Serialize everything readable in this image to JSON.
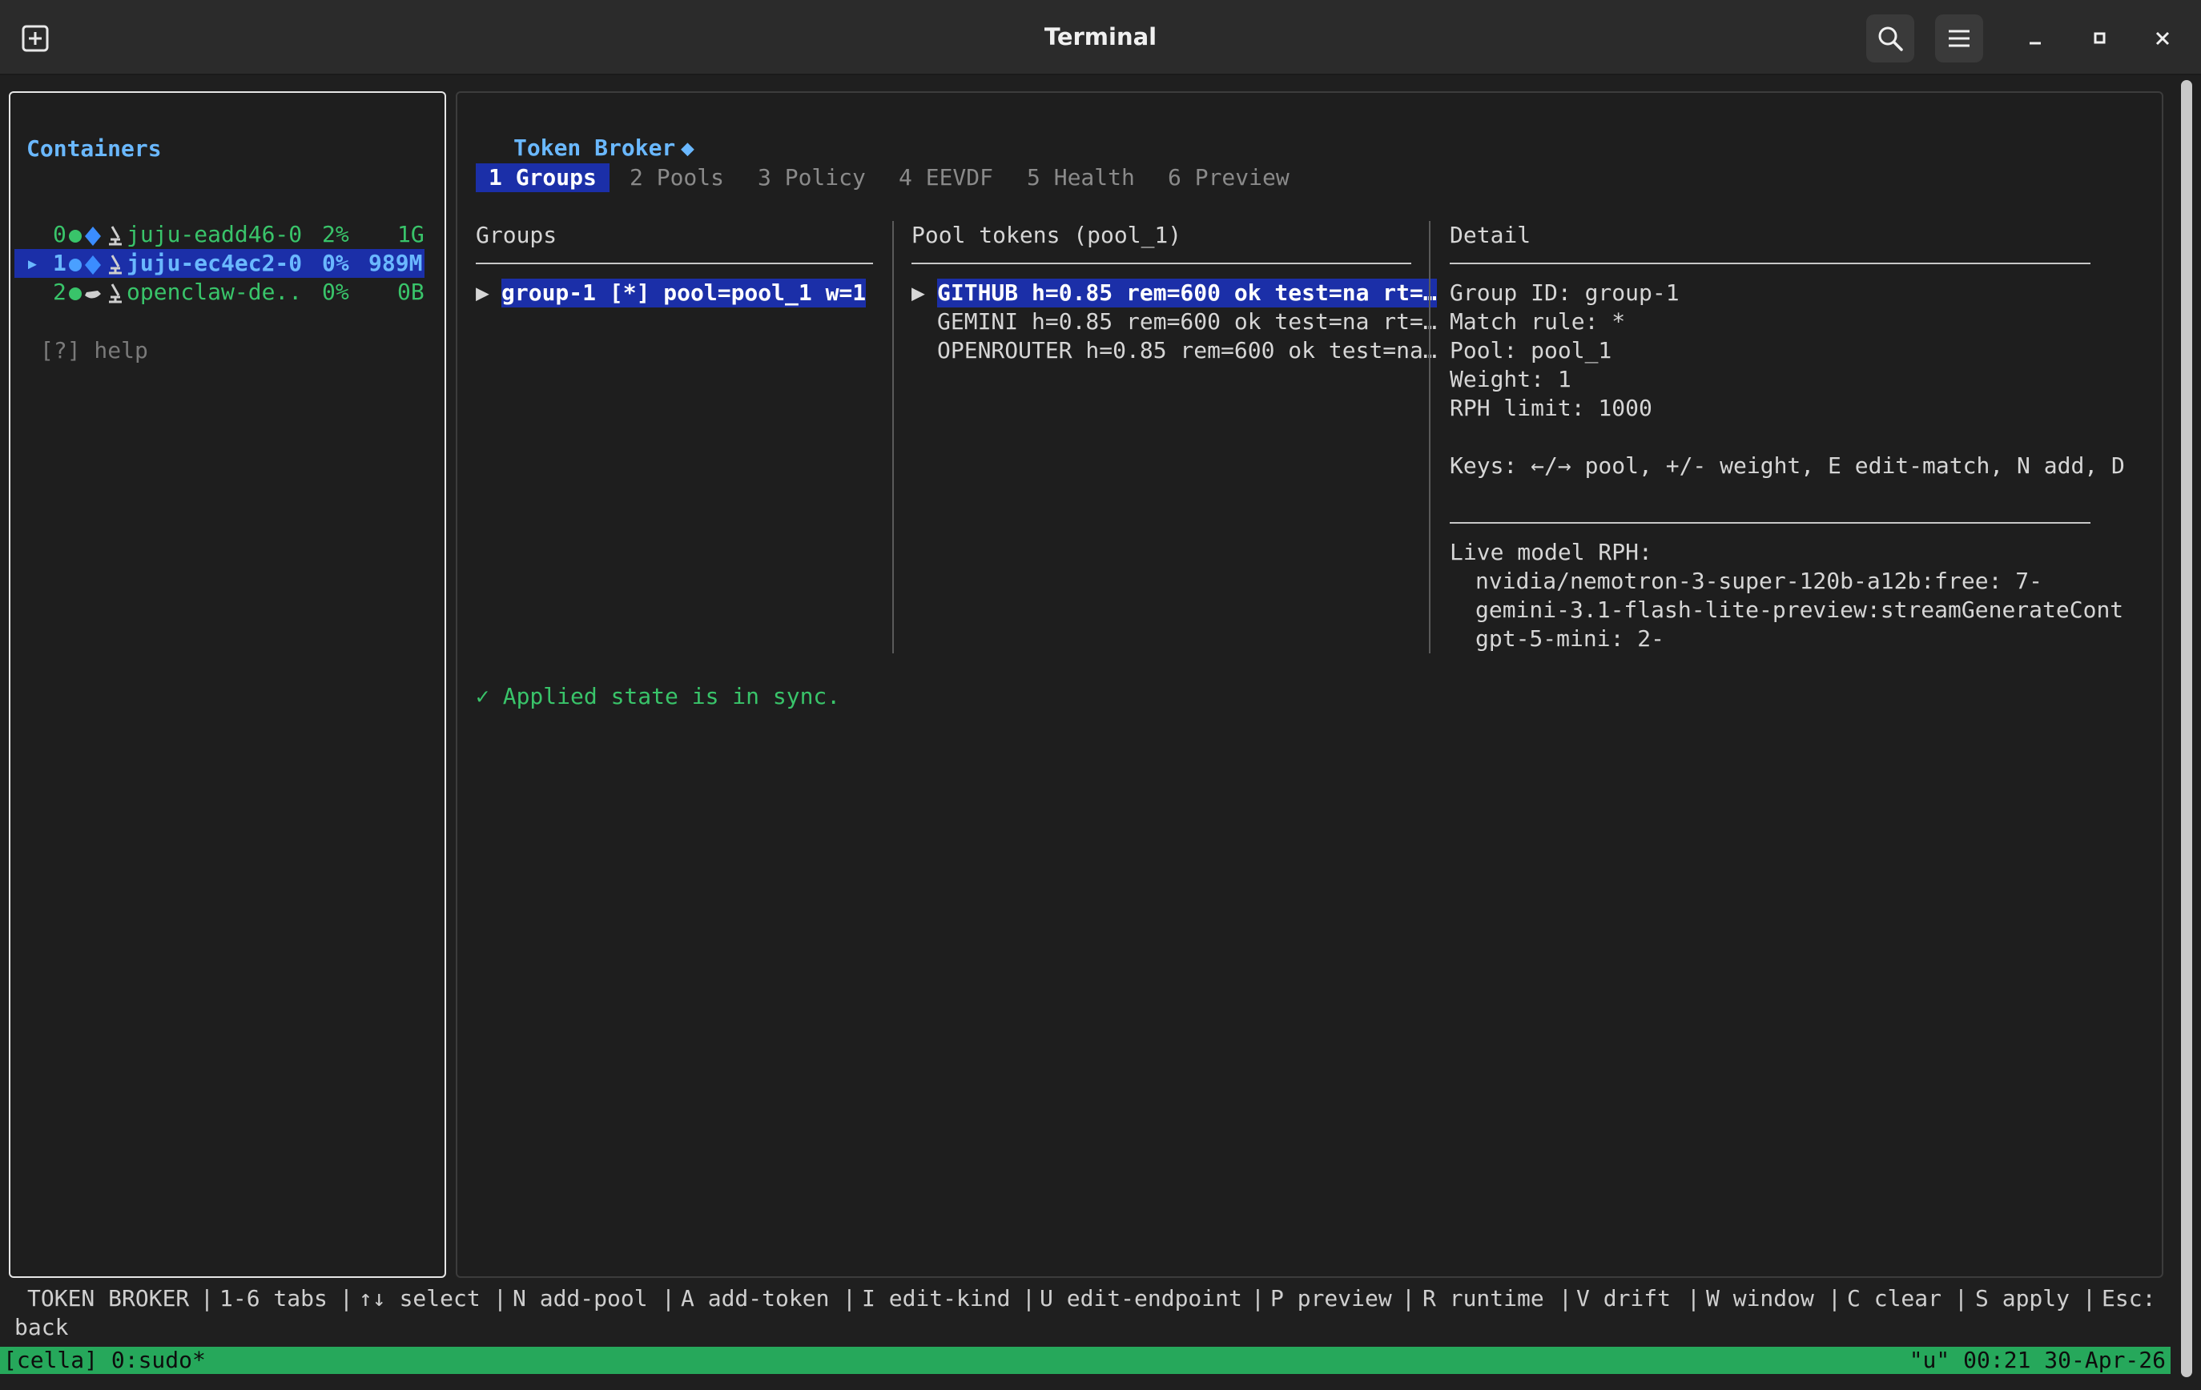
{
  "window": {
    "title": "Terminal"
  },
  "sidebar": {
    "title": "Containers",
    "rows": [
      {
        "index": "0",
        "name": "juju-eadd46-0",
        "cpu": "2%",
        "mem": "1G",
        "selected": false
      },
      {
        "index": "1",
        "name": "juju-ec4ec2-0",
        "cpu": "0%",
        "mem": "989M",
        "selected": true
      },
      {
        "index": "2",
        "name": "openclaw-de..",
        "cpu": "0%",
        "mem": "0B",
        "selected": false
      }
    ],
    "pointer": "▸",
    "help": "[?] help"
  },
  "broker": {
    "title": "Token Broker",
    "diamond": "◆",
    "tabs": [
      {
        "label": "1 Groups",
        "active": true
      },
      {
        "label": "2 Pools",
        "active": false
      },
      {
        "label": "3 Policy",
        "active": false
      },
      {
        "label": "4 EEVDF",
        "active": false
      },
      {
        "label": "5 Health",
        "active": false
      },
      {
        "label": "6 Preview",
        "active": false
      }
    ],
    "groups": {
      "header": "Groups",
      "pointer": "▶",
      "items": [
        "group-1 [*] pool=pool_1 w=1"
      ]
    },
    "pool_tokens": {
      "header": "Pool tokens (pool_1)",
      "pointer": "▶",
      "items": [
        "GITHUB h=0.85 rem=600 ok test=na rt=…",
        "GEMINI h=0.85 rem=600 ok test=na rt=…",
        "OPENROUTER h=0.85 rem=600 ok test=na…"
      ]
    },
    "detail": {
      "header": "Detail",
      "lines": [
        "Group ID: group-1",
        "Match rule: *",
        "Pool: pool_1",
        "Weight: 1",
        "RPH limit: 1000"
      ],
      "keys": "Keys: ←/→ pool, +/- weight, E edit-match, N add, D",
      "live_title": "Live model RPH:",
      "live_lines": [
        "nvidia/nemotron-3-super-120b-a12b:free: 7-",
        "gemini-3.1-flash-lite-preview:streamGenerateCont",
        "gpt-5-mini: 2-"
      ]
    },
    "sync_status": "✓ Applied state is in sync."
  },
  "helpbar": {
    "items": [
      "TOKEN BROKER",
      "1-6 tabs",
      "↑↓ select",
      "N add-pool",
      "A add-token",
      "I edit-kind",
      "U edit-endpoint",
      "P preview",
      "R runtime",
      "V drift",
      "W window",
      "C clear",
      "S apply",
      "Esc:"
    ],
    "wrap": "back"
  },
  "statusbar": {
    "left": "[cella] 0:sudo*",
    "right": "\"u\" 00:21 30-Apr-26"
  },
  "colors": {
    "accent_blue": "#6ab8ff",
    "selection": "#1b2fa8",
    "ok_green": "#39c46a",
    "status_green": "#26a85b"
  }
}
